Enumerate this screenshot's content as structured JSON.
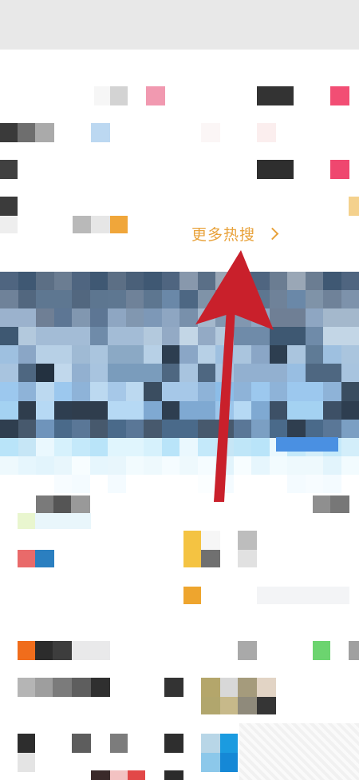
{
  "more_hot_search": {
    "label": "更多热搜",
    "chevron_icon": "chevron-right-icon"
  },
  "colors": {
    "accent": "#e8a23b",
    "arrow": "#c9202b",
    "video_tag": "#4a90e2"
  },
  "annotation": {
    "type": "arrow",
    "direction": "up",
    "target": "more-hot-search-link"
  }
}
